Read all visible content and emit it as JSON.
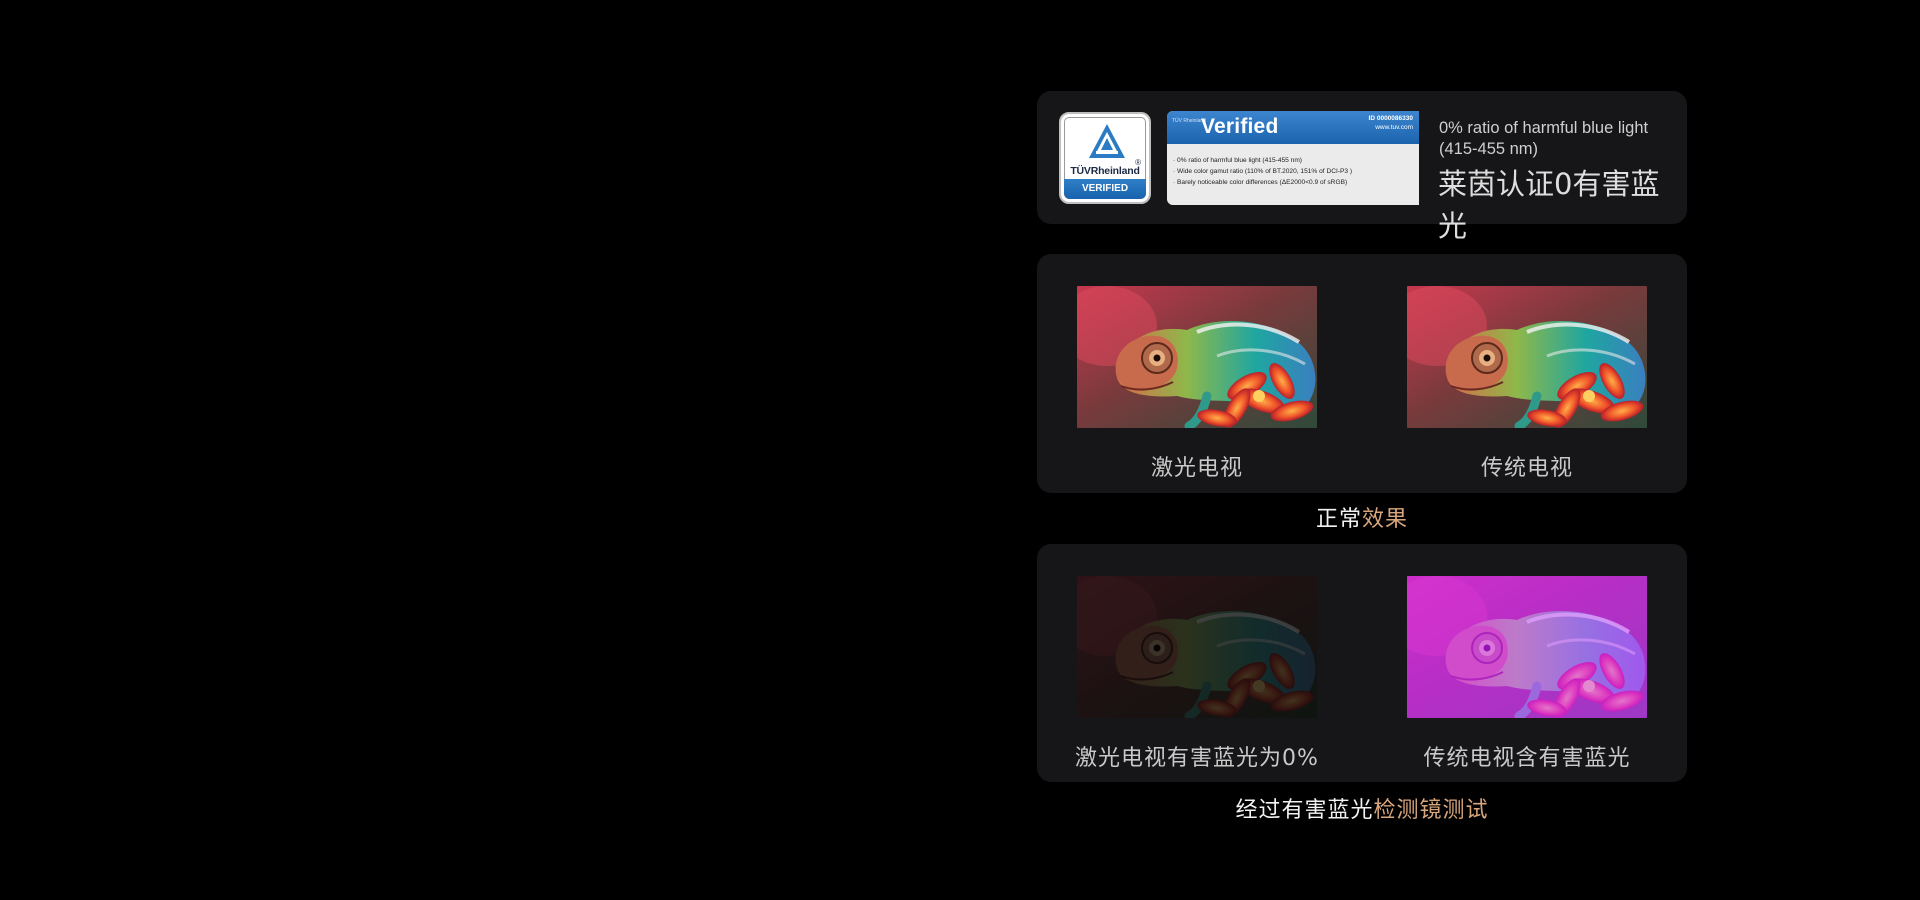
{
  "tuv": {
    "logo_brand": "TÜVRheinland",
    "logo_reg": "®",
    "logo_band": "VERIFIED",
    "certificate": {
      "small_brand": "TÜV Rheinland",
      "title": "Verified",
      "id": "ID 0000086330",
      "url": "www.tuv.com",
      "lines": [
        "· 0% ratio of harmful blue light (415-455 nm)",
        "· Wide color gamut ratio (110% of BT.2020, 151% of DCI-P3 )",
        "· Barely noticeable color differences (ΔE2000<0.9 of sRGB)"
      ]
    },
    "text_en": "0% ratio of harmful blue light (415-455 nm)",
    "text_zh": "莱茵认证0有害蓝光"
  },
  "normal": {
    "left_caption": "激光电视",
    "right_caption": "传统电视",
    "label_white": "正常",
    "label_gold": "效果"
  },
  "bluelight": {
    "left_caption": "激光电视有害蓝光为0%",
    "right_caption": "传统电视含有害蓝光",
    "label_white": "经过有害蓝光",
    "label_gold": "检测镜测试"
  },
  "colors": {
    "background": "#000000",
    "card": "#161618",
    "gold_accent": "#d8a67d",
    "tuv_blue": "#1b64ad"
  },
  "icons": {
    "tuv_logo": "tuv-rheinland-triangle-logo",
    "chameleon_image": "chameleon-photo"
  }
}
